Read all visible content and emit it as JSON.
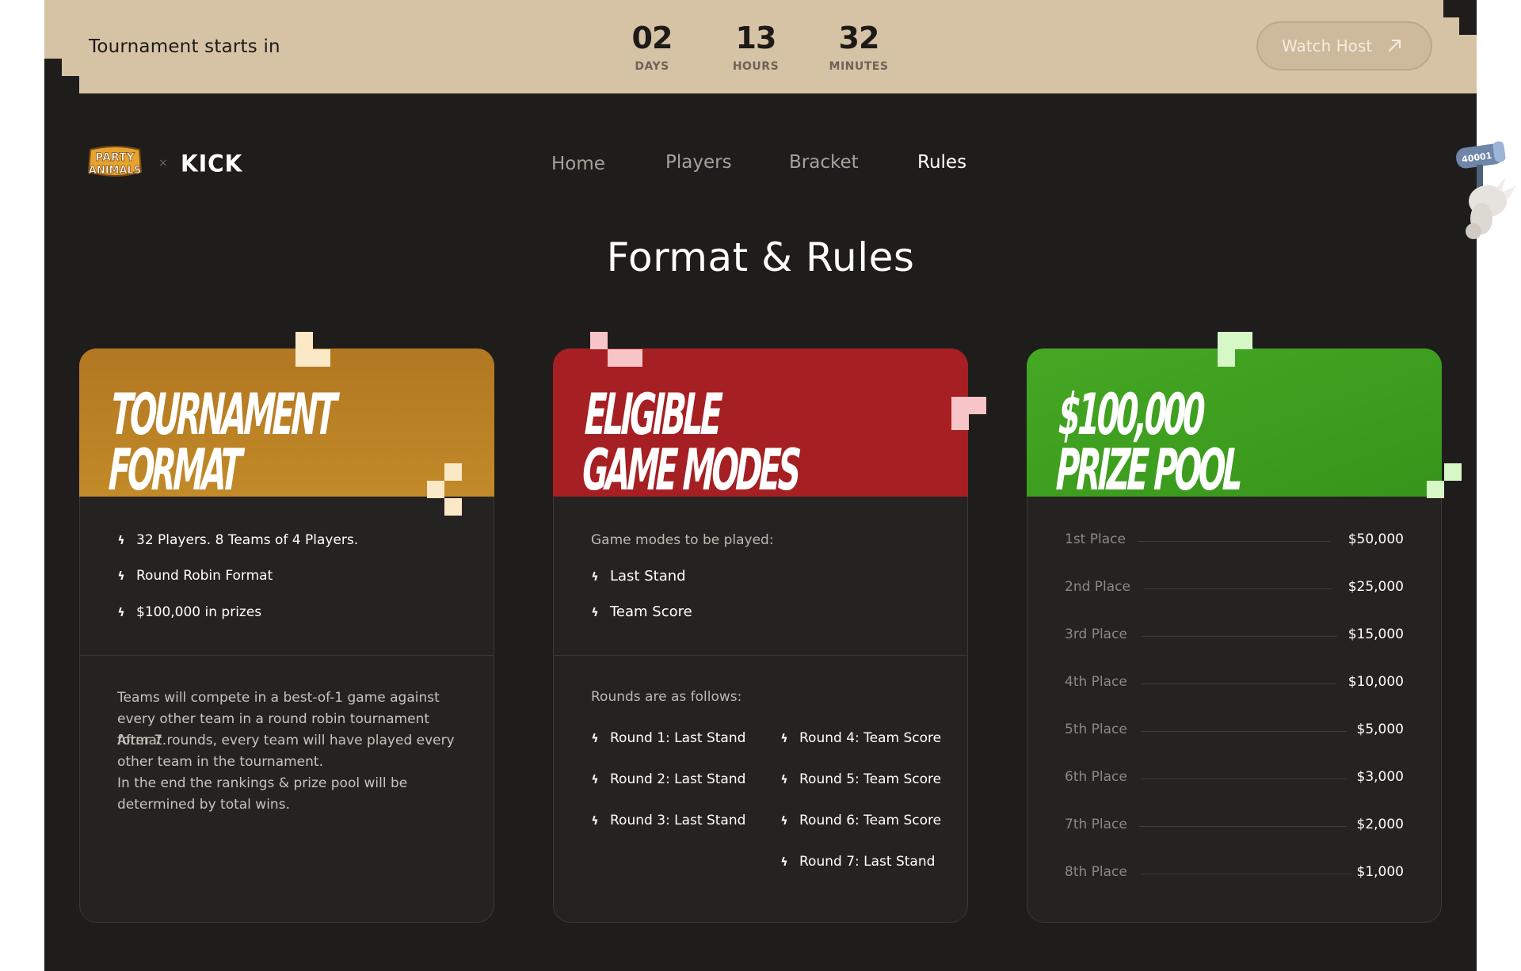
{
  "banner": {
    "title": "Tournament starts in",
    "countdown": [
      {
        "value": "02",
        "unit": "DAYS"
      },
      {
        "value": "13",
        "unit": "HOURS"
      },
      {
        "value": "32",
        "unit": "MINUTES"
      }
    ],
    "watch_label": "Watch Host"
  },
  "logos": {
    "partner_top": "PARTY",
    "partner_bottom": "ANIMALS",
    "separator": "×",
    "kick": "KICK"
  },
  "nav": [
    "Home",
    "Players",
    "Bracket",
    "Rules"
  ],
  "nav_active": "Rules",
  "creature_sign": "40001",
  "page_title": "Format & Rules",
  "cards": {
    "format": {
      "title_line1": "TOURNAMENT",
      "title_line2": "FORMAT",
      "color": "#b87f22",
      "bullets": [
        "32 Players. 8 Teams of 4 Players.",
        "Round Robin Format",
        "$100,000 in prizes"
      ],
      "paragraphs": [
        "Teams will compete in a best-of-1 game against every other team in a round robin tournament format.",
        "After 7 rounds, every team will have played every other team in the tournament.",
        "In the end the rankings & prize pool will be determined by total wins."
      ]
    },
    "modes": {
      "title_line1": "ELIGIBLE",
      "title_line2": "GAME MODES",
      "color": "#a61f22",
      "intro": "Game modes to be played:",
      "modes": [
        "Last Stand",
        "Team Score"
      ],
      "rounds_intro": "Rounds are as follows:",
      "rounds_left": [
        "Round 1: Last Stand",
        "Round 2: Last Stand",
        "Round 3: Last Stand"
      ],
      "rounds_right": [
        "Round 4: Team Score",
        "Round 5: Team Score",
        "Round 6: Team Score",
        "Round 7: Last Stand"
      ]
    },
    "prize": {
      "title_line1": "$100,000",
      "title_line2": "PRIZE POOL",
      "color": "#3b9a1f",
      "places": [
        {
          "place": "1st Place",
          "amount": "$50,000"
        },
        {
          "place": "2nd Place",
          "amount": "$25,000"
        },
        {
          "place": "3rd Place",
          "amount": "$15,000"
        },
        {
          "place": "4th Place",
          "amount": "$10,000"
        },
        {
          "place": "5th Place",
          "amount": "$5,000"
        },
        {
          "place": "6th Place",
          "amount": "$3,000"
        },
        {
          "place": "7th Place",
          "amount": "$2,000"
        },
        {
          "place": "8th Place",
          "amount": "$1,000"
        }
      ]
    }
  }
}
